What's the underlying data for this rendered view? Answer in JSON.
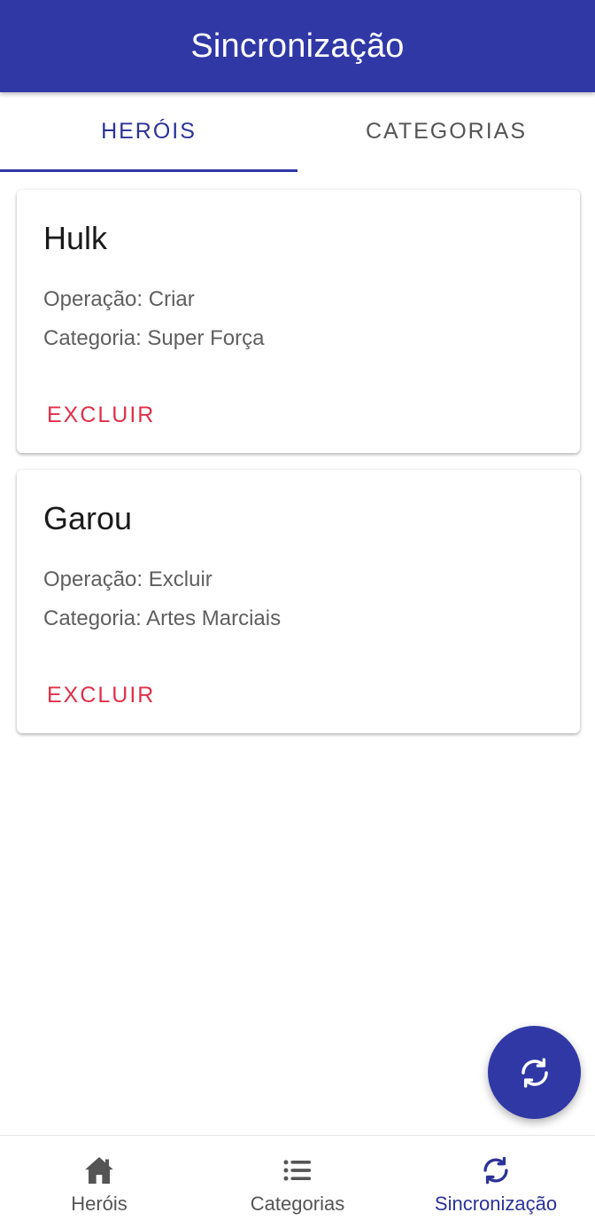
{
  "appbar": {
    "title": "Sincronização"
  },
  "tabs": [
    {
      "label": "HERÓIS",
      "active": true
    },
    {
      "label": "CATEGORIAS",
      "active": false
    }
  ],
  "cards": [
    {
      "name": "Hulk",
      "operation_key": "Operação:",
      "operation_value": "Criar",
      "category_key": "Categoria:",
      "category_value": "Super Força",
      "action_label": "EXCLUIR"
    },
    {
      "name": "Garou",
      "operation_key": "Operação:",
      "operation_value": "Excluir",
      "category_key": "Categoria:",
      "category_value": "Artes Marciais",
      "action_label": "EXCLUIR"
    }
  ],
  "fab": {
    "icon": "sync-icon"
  },
  "bottom_nav": [
    {
      "label": "Heróis",
      "icon": "home-icon",
      "active": false
    },
    {
      "label": "Categorias",
      "icon": "list-icon",
      "active": false
    },
    {
      "label": "Sincronização",
      "icon": "sync-icon",
      "active": true
    }
  ],
  "colors": {
    "primary": "#3038a6",
    "danger": "#e0304a",
    "text_secondary": "#5f5f5f"
  }
}
